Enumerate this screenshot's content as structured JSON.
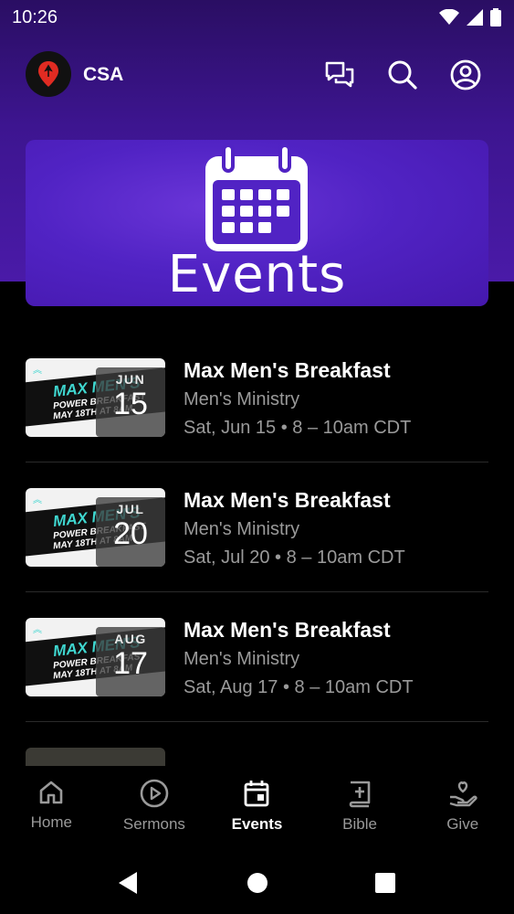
{
  "status_bar": {
    "time": "10:26"
  },
  "header": {
    "brand": "CSA"
  },
  "banner": {
    "title": "Events"
  },
  "events": [
    {
      "title": "Max Men's Breakfast",
      "ministry": "Men's Ministry",
      "time": "Sat, Jun 15 • 8 – 10am CDT",
      "month": "JUN",
      "day": "15",
      "thumb_line1": "MAX MEN'S",
      "thumb_line2": "POWER BREAKFAST",
      "thumb_line3": "MAY 18TH AT 8AM"
    },
    {
      "title": "Max Men's Breakfast",
      "ministry": "Men's Ministry",
      "time": "Sat, Jul 20 • 8 – 10am CDT",
      "month": "JUL",
      "day": "20",
      "thumb_line1": "MAX MEN'S",
      "thumb_line2": "POWER BREAKFAST",
      "thumb_line3": "MAY 18TH AT 8AM"
    },
    {
      "title": "Max Men's Breakfast",
      "ministry": "Men's Ministry",
      "time": "Sat, Aug 17 • 8 – 10am CDT",
      "month": "AUG",
      "day": "17",
      "thumb_line1": "MAX MEN'S",
      "thumb_line2": "POWER BREAKFAST",
      "thumb_line3": "MAY 18TH AT 8AM"
    }
  ],
  "bottom_nav": [
    {
      "label": "Home",
      "icon": "home-icon",
      "active": false
    },
    {
      "label": "Sermons",
      "icon": "play-circle-icon",
      "active": false
    },
    {
      "label": "Events",
      "icon": "calendar-icon",
      "active": true
    },
    {
      "label": "Bible",
      "icon": "bible-icon",
      "active": false
    },
    {
      "label": "Give",
      "icon": "give-hand-heart-icon",
      "active": false
    }
  ],
  "colors": {
    "accent_purple": "#4a1aa8",
    "banner_purple": "#5123c4",
    "thumb_accent": "#3fd7d0",
    "muted_text": "#9a9a9a"
  }
}
